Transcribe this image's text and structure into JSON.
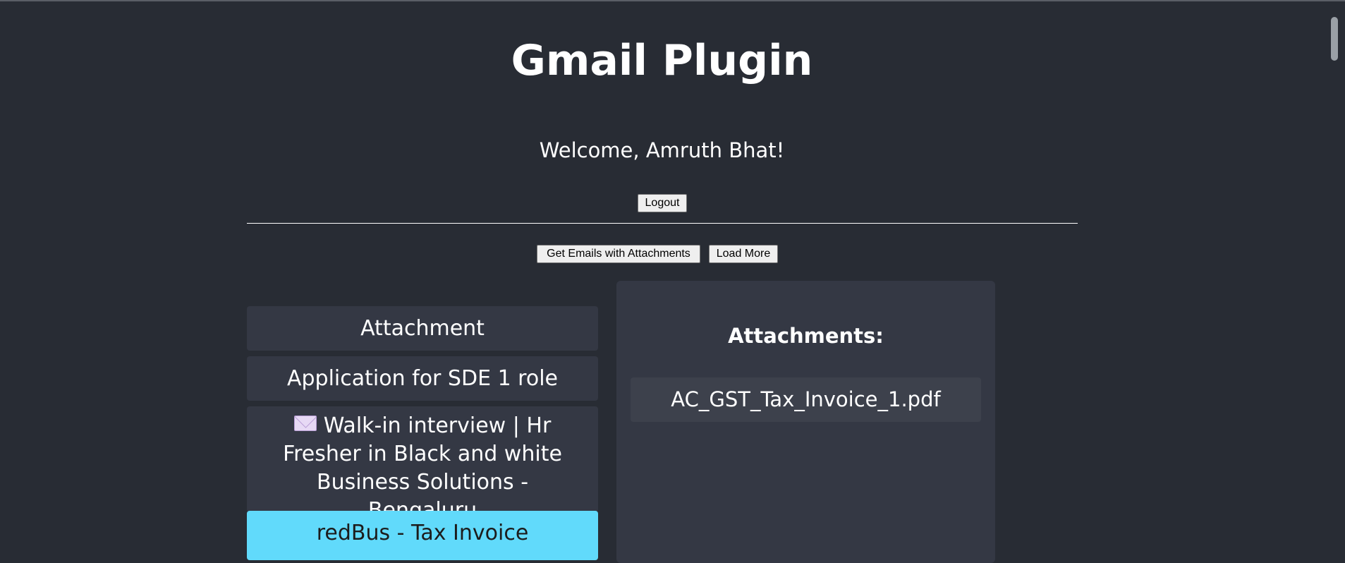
{
  "header": {
    "title": "Gmail Plugin",
    "welcome": "Welcome, Amruth Bhat!",
    "logout_label": "Logout"
  },
  "toolbar": {
    "get_emails_label": "Get Emails with Attachments",
    "load_more_label": "Load More"
  },
  "emails": [
    {
      "subject": "Attachment",
      "selected": false
    },
    {
      "subject": "Application for SDE 1 role",
      "selected": false
    },
    {
      "subject": "Walk-in interview | Hr Fresher in Black and white Business Solutions - Bengaluru",
      "selected": false,
      "icon": "envelope-icon"
    },
    {
      "subject": "redBus - Tax Invoice",
      "selected": true
    }
  ],
  "attachments_panel": {
    "heading": "Attachments:",
    "files": [
      "AC_GST_Tax_Invoice_1.pdf"
    ]
  },
  "colors": {
    "background": "#282c34",
    "card": "#343844",
    "selected": "#61dafb"
  }
}
